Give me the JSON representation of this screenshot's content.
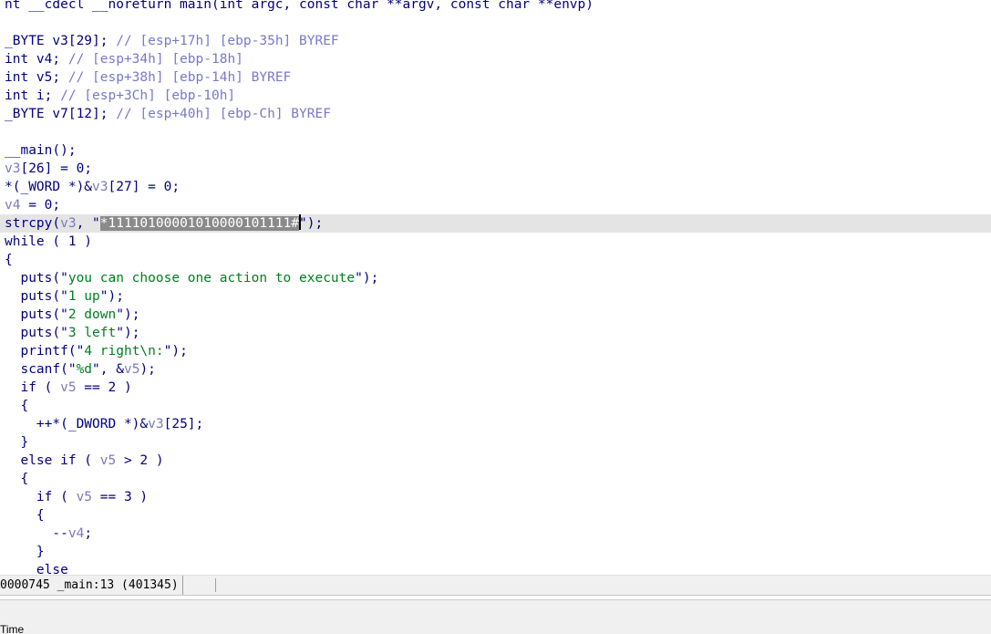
{
  "code": {
    "lines": [
      [
        {
          "t": "nt __cdecl __noreturn main(int argc, const char **argv, const char **envp)",
          "c": "text"
        }
      ],
      [],
      [
        {
          "t": "_BYTE v3[29]; ",
          "c": "text"
        },
        {
          "t": "// [esp+17h] [ebp-35h] BYREF",
          "c": "comment"
        }
      ],
      [
        {
          "t": "int v4; ",
          "c": "text"
        },
        {
          "t": "// [esp+34h] [ebp-18h]",
          "c": "comment"
        }
      ],
      [
        {
          "t": "int v5; ",
          "c": "text"
        },
        {
          "t": "// [esp+38h] [ebp-14h] BYREF",
          "c": "comment"
        }
      ],
      [
        {
          "t": "int i; ",
          "c": "text"
        },
        {
          "t": "// [esp+3Ch] [ebp-10h]",
          "c": "comment"
        }
      ],
      [
        {
          "t": "_BYTE v7[12]; ",
          "c": "text"
        },
        {
          "t": "// [esp+40h] [ebp-Ch] BYREF",
          "c": "comment"
        }
      ],
      [],
      [
        {
          "t": "__main();",
          "c": "text"
        }
      ],
      [
        {
          "t": "v3",
          "c": "var"
        },
        {
          "t": "[26] = 0;",
          "c": "text"
        }
      ],
      [
        {
          "t": "*(_WORD *)&",
          "c": "text"
        },
        {
          "t": "v3",
          "c": "var"
        },
        {
          "t": "[27] = 0;",
          "c": "text"
        }
      ],
      [
        {
          "t": "v4",
          "c": "var"
        },
        {
          "t": " = 0;",
          "c": "text"
        }
      ],
      [
        {
          "t": "strcpy(",
          "c": "text"
        },
        {
          "t": "v3",
          "c": "var"
        },
        {
          "t": ", \"",
          "c": "text"
        },
        {
          "t": "*11110100001010000101111#",
          "c": "sel"
        },
        {
          "t": "",
          "c": "caret"
        },
        {
          "t": "\");",
          "c": "text"
        }
      ],
      [
        {
          "t": "while ( 1 )",
          "c": "text"
        }
      ],
      [
        {
          "t": "{",
          "c": "text"
        }
      ],
      [
        {
          "t": "  puts(\"",
          "c": "text"
        },
        {
          "t": "you can choose one action to execute",
          "c": "string"
        },
        {
          "t": "\");",
          "c": "text"
        }
      ],
      [
        {
          "t": "  puts(\"",
          "c": "text"
        },
        {
          "t": "1 up",
          "c": "string"
        },
        {
          "t": "\");",
          "c": "text"
        }
      ],
      [
        {
          "t": "  puts(\"",
          "c": "text"
        },
        {
          "t": "2 down",
          "c": "string"
        },
        {
          "t": "\");",
          "c": "text"
        }
      ],
      [
        {
          "t": "  puts(\"",
          "c": "text"
        },
        {
          "t": "3 left",
          "c": "string"
        },
        {
          "t": "\");",
          "c": "text"
        }
      ],
      [
        {
          "t": "  printf(\"",
          "c": "text"
        },
        {
          "t": "4 right\\n:",
          "c": "string"
        },
        {
          "t": "\");",
          "c": "text"
        }
      ],
      [
        {
          "t": "  scanf(\"",
          "c": "text"
        },
        {
          "t": "%d",
          "c": "string"
        },
        {
          "t": "\", &",
          "c": "text"
        },
        {
          "t": "v5",
          "c": "var"
        },
        {
          "t": ");",
          "c": "text"
        }
      ],
      [
        {
          "t": "  if ( ",
          "c": "text"
        },
        {
          "t": "v5",
          "c": "var"
        },
        {
          "t": " == 2 )",
          "c": "text"
        }
      ],
      [
        {
          "t": "  {",
          "c": "text"
        }
      ],
      [
        {
          "t": "    ++*(_DWORD *)&",
          "c": "text"
        },
        {
          "t": "v3",
          "c": "var"
        },
        {
          "t": "[25];",
          "c": "text"
        }
      ],
      [
        {
          "t": "  }",
          "c": "text"
        }
      ],
      [
        {
          "t": "  else if ( ",
          "c": "text"
        },
        {
          "t": "v5",
          "c": "var"
        },
        {
          "t": " > 2 )",
          "c": "text"
        }
      ],
      [
        {
          "t": "  {",
          "c": "text"
        }
      ],
      [
        {
          "t": "    if ( ",
          "c": "text"
        },
        {
          "t": "v5",
          "c": "var"
        },
        {
          "t": " == 3 )",
          "c": "text"
        }
      ],
      [
        {
          "t": "    {",
          "c": "text"
        }
      ],
      [
        {
          "t": "      --",
          "c": "text"
        },
        {
          "t": "v4",
          "c": "var"
        },
        {
          "t": ";",
          "c": "text"
        }
      ],
      [
        {
          "t": "    }",
          "c": "text"
        }
      ],
      [
        {
          "t": "    else",
          "c": "text"
        }
      ]
    ],
    "current_line": 12
  },
  "status_bar": {
    "address": "0000745 _main:13 (401345)"
  },
  "output_panel": {
    "tab_label": "Time"
  },
  "colors": {
    "text": "#000080",
    "comment": "#7878cc",
    "variable": "#7a7ac0",
    "string": "#00801e",
    "current_line_bg": "#e4e4e4",
    "selection_bg": "#8a8a8a"
  }
}
